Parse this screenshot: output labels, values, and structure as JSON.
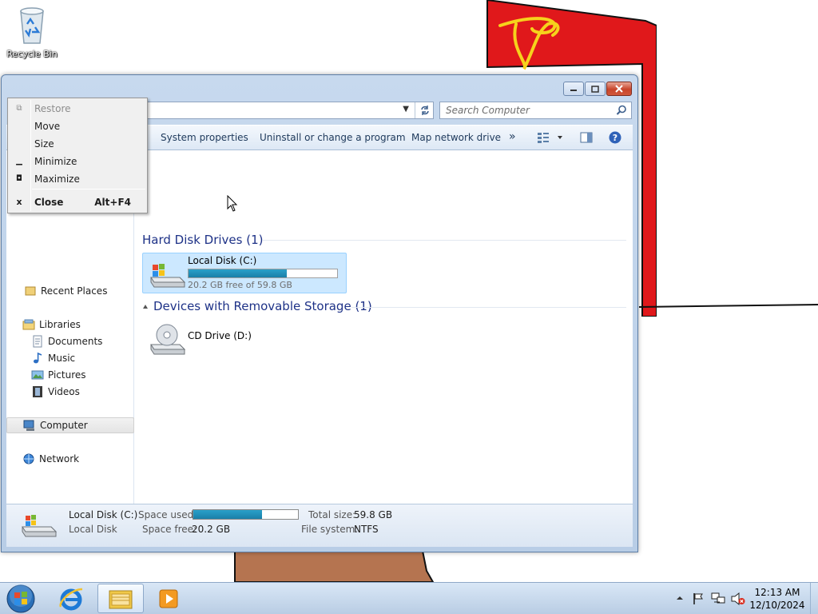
{
  "desktop": {
    "recycle_bin_label": "Recycle Bin"
  },
  "window": {
    "search_placeholder": "Search Computer",
    "toolbar": {
      "system_properties": "System properties",
      "uninstall": "Uninstall or change a program",
      "map_network_drive": "Map network drive",
      "more": "»"
    },
    "nav": {
      "recent_places": "Recent Places",
      "libraries": "Libraries",
      "documents": "Documents",
      "music": "Music",
      "pictures": "Pictures",
      "videos": "Videos",
      "computer": "Computer",
      "network": "Network"
    },
    "groups": {
      "hdd": "Hard Disk Drives (1)",
      "removable": "Devices with Removable Storage (1)"
    },
    "drives": {
      "c_name": "Local Disk (C:)",
      "c_free": "20.2 GB free of 59.8 GB",
      "c_used_fraction": 0.66,
      "d_name": "CD Drive (D:)"
    },
    "details": {
      "name": "Local Disk (C:)",
      "type": "Local Disk",
      "space_used_label": "Space used:",
      "space_free_label": "Space free:",
      "space_free_value": "20.2 GB",
      "total_size_label": "Total size:",
      "total_size_value": "59.8 GB",
      "file_system_label": "File system:",
      "file_system_value": "NTFS"
    }
  },
  "system_menu": {
    "restore": "Restore",
    "move": "Move",
    "size": "Size",
    "minimize": "Minimize",
    "maximize": "Maximize",
    "close": "Close",
    "close_accel": "Alt+F4"
  },
  "taskbar": {
    "time": "12:13 AM",
    "date": "12/10/2024"
  },
  "colors": {
    "accent_bar": "#1a7fa8",
    "flag_red": "#e0181b",
    "flag_symbol": "#f6d21c",
    "trunk": "#b57450"
  }
}
